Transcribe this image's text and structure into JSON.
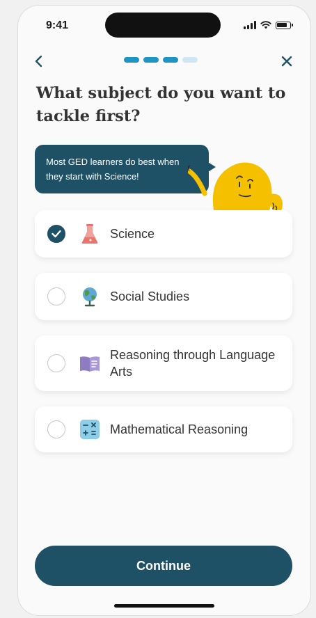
{
  "status_bar": {
    "time": "9:41"
  },
  "nav": {
    "back_icon": "chevron-left-icon",
    "close_icon": "close-icon"
  },
  "progress": {
    "total_steps": 4,
    "completed_steps": 3,
    "active_color": "#1e94c4",
    "inactive_color": "#cfe7f2"
  },
  "question": "What subject do you want to tackle first?",
  "tip": {
    "text": "Most GED learners do best when they start with Science!"
  },
  "options": [
    {
      "label": "Science",
      "icon": "flask-icon",
      "selected": true
    },
    {
      "label": "Social Studies",
      "icon": "globe-icon",
      "selected": false
    },
    {
      "label": "Reasoning through Language Arts",
      "icon": "book-icon",
      "selected": false
    },
    {
      "label": "Mathematical Reasoning",
      "icon": "calculator-icon",
      "selected": false
    }
  ],
  "continue_label": "Continue",
  "colors": {
    "primary": "#1f5166",
    "mascot": "#f5c000"
  }
}
